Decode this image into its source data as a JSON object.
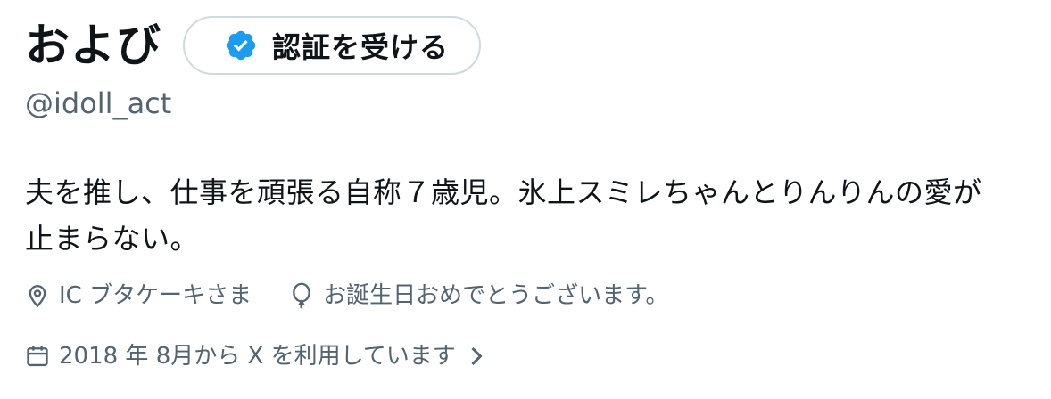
{
  "profile": {
    "display_name": "および",
    "handle": "@idoll_act",
    "verify_button_label": "認証を受ける",
    "bio_line1": "夫を推し、仕事を頑張る自称７歳児。氷上スミレちゃんとりんりんの愛が",
    "bio_line2": "止まらない。",
    "location": "IC ブタケーキさま",
    "birthday": "お誕生日おめでとうございます。",
    "joined": "2018 年 8月から X を利用しています"
  },
  "icons": {
    "verify": "verified-badge-icon",
    "location": "location-pin-icon",
    "birthday": "balloon-icon",
    "joined": "calendar-icon",
    "joined_chevron": "chevron-right-icon"
  },
  "colors": {
    "primary_text": "#0f1419",
    "secondary_text": "#536471",
    "verified_blue": "#1d9bf0",
    "button_border": "#cfd9de"
  }
}
